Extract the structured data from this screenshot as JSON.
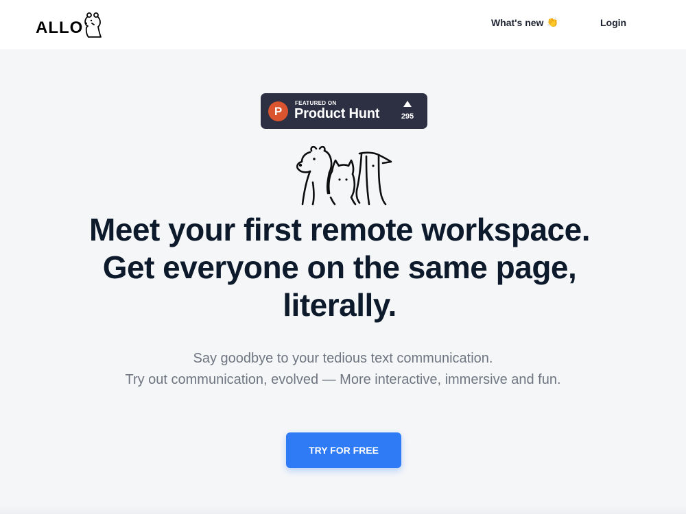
{
  "header": {
    "logo_text": "ALLO",
    "nav": {
      "whats_new": "What's new",
      "whats_new_emoji": "👏",
      "login": "Login"
    }
  },
  "product_hunt": {
    "featured_on": "FEATURED ON",
    "name": "Product Hunt",
    "logo_letter": "P",
    "upvotes": "295"
  },
  "hero": {
    "headline_line1": "Meet your first remote workspace.",
    "headline_line2": "Get everyone on the same page,",
    "headline_line3": "literally.",
    "subtext_line1": "Say goodbye to your tedious text communication.",
    "subtext_line2": "Try out communication, evolved — More interactive, immersive and fun.",
    "cta_label": "TRY FOR FREE"
  },
  "colors": {
    "cta": "#2f7bf5",
    "product_hunt_badge": "#2d2f42",
    "product_hunt_logo": "#da552f",
    "headline": "#0d1a2b",
    "subtext": "#6e7580"
  },
  "icons": [
    "bear-logo-icon",
    "clap-emoji-icon",
    "product-hunt-logo-icon",
    "upvote-arrow-icon",
    "mascots-illustration"
  ]
}
